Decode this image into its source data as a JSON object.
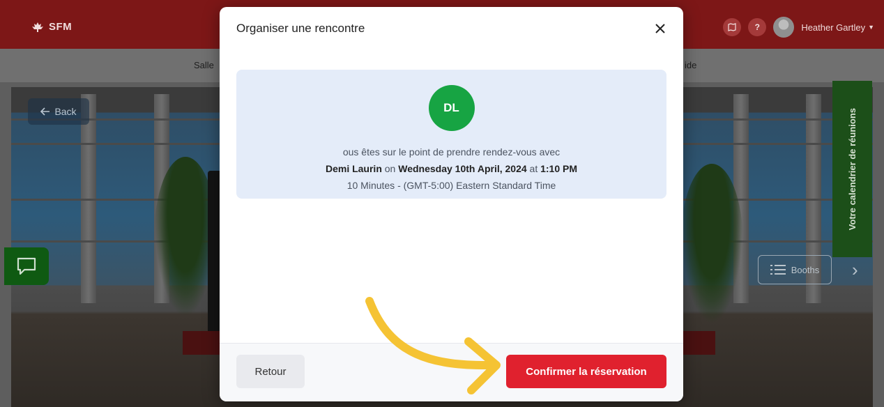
{
  "header": {
    "logo_text": "SFM",
    "user_name": "Heather Gartley",
    "help_label": "?"
  },
  "nav": {
    "left_item": "Salle",
    "right_item": "ide"
  },
  "scene": {
    "back_label": "Back",
    "calendar_tab_label": "Votre calendrier de réunions",
    "booths_label": "Booths"
  },
  "modal": {
    "title": "Organiser une rencontre",
    "host_initials": "DL",
    "message_intro": "ous êtes sur le point de prendre rendez-vous avec",
    "host_name": "Demi Laurin",
    "on_word": "on",
    "date": "Wednesday 10th April, 2024",
    "at_word": "at",
    "time": "1:10 PM",
    "duration_tz": "10 Minutes - (GMT-5:00) Eastern Standard Time",
    "back_button": "Retour",
    "confirm_button": "Confirmer la réservation"
  },
  "colors": {
    "brand_red": "#e0212e",
    "avatar_green": "#17a443",
    "card_blue": "#e4ecf9",
    "annotation_yellow": "#f5c334"
  }
}
